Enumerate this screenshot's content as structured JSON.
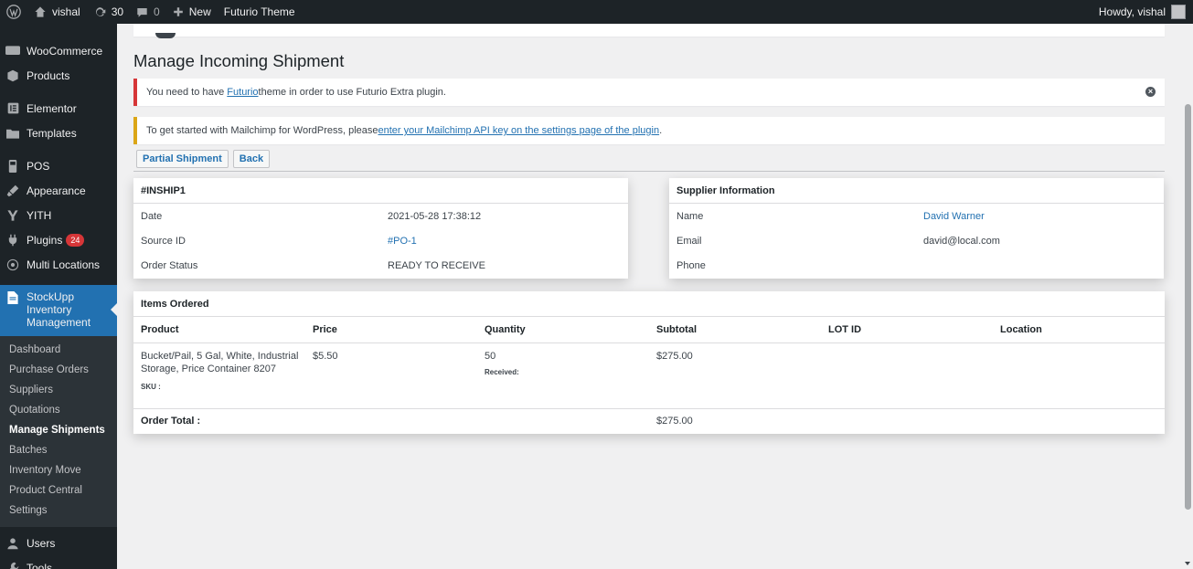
{
  "adminbar": {
    "site_name": "vishal",
    "updates_count": "30",
    "comments_count": "0",
    "new_label": "New",
    "theme_label": "Futurio Theme",
    "howdy": "Howdy, vishal"
  },
  "sidebar": {
    "items": [
      {
        "label": "WooCommerce",
        "icon": "woo-icon"
      },
      {
        "label": "Products",
        "icon": "box-icon"
      },
      {
        "label": "Elementor",
        "icon": "elementor-icon"
      },
      {
        "label": "Templates",
        "icon": "folder-icon"
      },
      {
        "label": "POS",
        "icon": "pos-icon"
      },
      {
        "label": "Appearance",
        "icon": "brush-icon"
      },
      {
        "label": "YITH",
        "icon": "yith-icon"
      },
      {
        "label": "Plugins",
        "icon": "plugin-icon",
        "badge": "24"
      },
      {
        "label": "Multi Locations",
        "icon": "locations-icon"
      },
      {
        "label": "StockUpp Inventory Management",
        "icon": "document-icon"
      }
    ],
    "submenu": [
      "Dashboard",
      "Purchase Orders",
      "Suppliers",
      "Quotations",
      "Manage Shipments",
      "Batches",
      "Inventory Move",
      "Product Central",
      "Settings"
    ],
    "bottom_items": [
      {
        "label": "Users",
        "icon": "users-icon"
      },
      {
        "label": "Tools",
        "icon": "wrench-icon"
      }
    ]
  },
  "page": {
    "title": "Manage Incoming Shipment",
    "notice_error": {
      "before": "You need to have ",
      "link": "Futurio",
      "after": " theme in order to use Futurio Extra plugin."
    },
    "notice_warn": {
      "before": "To get started with Mailchimp for WordPress, please ",
      "link": "enter your Mailchimp API key on the settings page of the plugin",
      "after": "."
    },
    "buttons": {
      "partial": "Partial Shipment",
      "back": "Back"
    }
  },
  "shipment": {
    "id": "#INSHIP1",
    "rows": [
      {
        "label": "Date",
        "value": "2021-05-28 17:38:12"
      },
      {
        "label": "Source ID",
        "value": "#PO-1"
      },
      {
        "label": "Order Status",
        "value": "READY TO RECEIVE"
      }
    ]
  },
  "supplier": {
    "title": "Supplier Information",
    "rows": [
      {
        "label": "Name",
        "value": "David Warner"
      },
      {
        "label": "Email",
        "value": "david@local.com"
      },
      {
        "label": "Phone",
        "value": ""
      }
    ]
  },
  "items": {
    "title": "Items Ordered",
    "columns": [
      "Product",
      "Price",
      "Quantity",
      "Subtotal",
      "LOT ID",
      "Location"
    ],
    "rows": [
      {
        "product": "Bucket/Pail, 5 Gal, White, Industrial Storage, Price Container 8207",
        "sku_label": "SKU :",
        "price": "$5.50",
        "quantity": "50",
        "received_label": "Received:",
        "subtotal": "$275.00",
        "lot_id": "",
        "location": ""
      }
    ],
    "total_label": "Order Total :",
    "total_value": "$275.00"
  },
  "colors": {
    "accent": "#2271b1",
    "sidebar": "#1d2327",
    "error": "#d63638",
    "warning": "#dba617"
  }
}
